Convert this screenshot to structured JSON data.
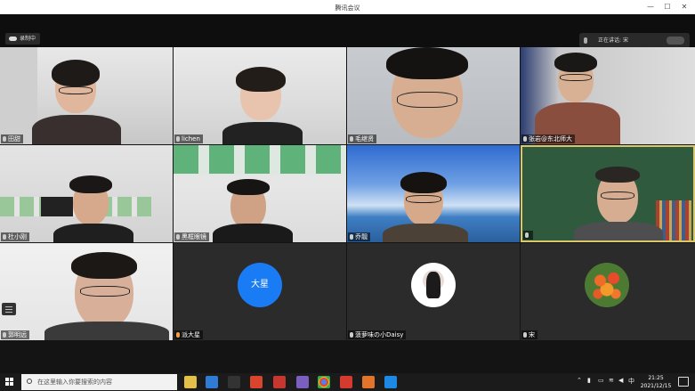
{
  "window": {
    "title": "腾讯会议",
    "minimize": "—",
    "maximize": "☐",
    "close": "✕"
  },
  "status": {
    "recording": "录制中",
    "speaking_label": "正在讲话:",
    "speaking_name": "宋"
  },
  "participants": [
    {
      "name": "田甜"
    },
    {
      "name": "lichen"
    },
    {
      "name": "毛继贤"
    },
    {
      "name": "张岩@东北师大"
    },
    {
      "name": "杜小刚"
    },
    {
      "name": "黑框眼镜"
    },
    {
      "name": "乔靓"
    },
    {
      "name": ""
    },
    {
      "name": "郭明远"
    },
    {
      "name": "派大星",
      "avatar_text": "大星"
    },
    {
      "name": "菠萝味の小Daisy"
    },
    {
      "name": "宋"
    }
  ],
  "taskbar": {
    "search_placeholder": "在这里输入你要搜索的内容",
    "tray_ime": "中",
    "time": "21:25",
    "date": "2021/12/15"
  },
  "colors": {
    "accent_blue": "#1a7cf5",
    "taskbar": "#1b1b1b",
    "tile_dark": "#2b2b2b"
  },
  "icons": [
    "windows-start-icon",
    "search-icon",
    "mic-icon",
    "cloud-icon",
    "sidebar-toggle-icon",
    "notification-icon"
  ]
}
